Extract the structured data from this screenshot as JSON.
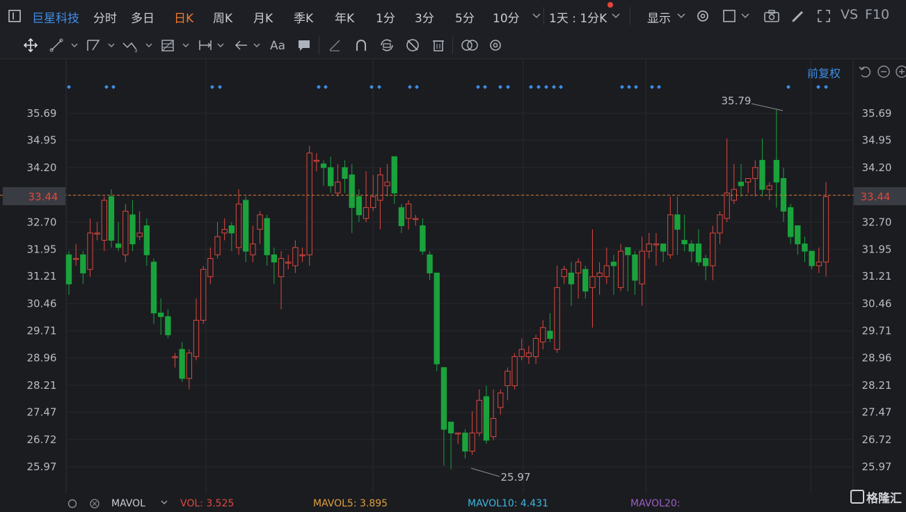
{
  "header": {
    "stock_name": "巨星科技",
    "periods": [
      "分时",
      "多日",
      "日K",
      "周K",
      "月K",
      "季K",
      "年K",
      "1分",
      "3分",
      "5分",
      "10分"
    ],
    "active_period": "日K",
    "interval_select": "1天 : 1分K",
    "display_label": "显示",
    "vs_label": "VS",
    "f10_label": "F10"
  },
  "toolbar": {
    "adjust_label": "前复权"
  },
  "price_axis": {
    "ticks": [
      "35.69",
      "34.95",
      "34.20",
      "33.44",
      "32.70",
      "31.95",
      "31.21",
      "30.46",
      "29.71",
      "28.96",
      "28.21",
      "27.47",
      "26.72",
      "25.97"
    ],
    "current_price": "33.44"
  },
  "annotations": {
    "high": "35.79",
    "low": "25.97"
  },
  "chart_data": {
    "type": "candlestick",
    "ylim": [
      25.6,
      36.2
    ],
    "up_color": "#e0483e",
    "down_color": "#1aa33c",
    "current_line": 33.44,
    "candles": [
      [
        31.8,
        31.0,
        31.9,
        30.7
      ],
      [
        31.7,
        31.7,
        32.1,
        31.5
      ],
      [
        31.8,
        31.3,
        31.9,
        31.0
      ],
      [
        31.4,
        32.4,
        32.8,
        31.2
      ],
      [
        32.4,
        32.4,
        32.7,
        32.2
      ],
      [
        32.2,
        33.3,
        33.4,
        31.9
      ],
      [
        33.4,
        32.2,
        33.6,
        32.0
      ],
      [
        32.1,
        32.0,
        32.7,
        31.9
      ],
      [
        31.8,
        33.0,
        33.2,
        31.6
      ],
      [
        32.9,
        32.1,
        33.3,
        31.9
      ],
      [
        32.3,
        32.4,
        33.0,
        32.2
      ],
      [
        32.6,
        31.8,
        32.8,
        31.5
      ],
      [
        31.6,
        30.2,
        31.7,
        29.9
      ],
      [
        30.2,
        30.1,
        30.6,
        29.6
      ],
      [
        30.1,
        29.6,
        30.3,
        29.5
      ],
      [
        29.0,
        29.0,
        29.1,
        28.7
      ],
      [
        29.2,
        28.4,
        29.4,
        28.3
      ],
      [
        28.4,
        29.1,
        29.2,
        28.1
      ],
      [
        29.0,
        30.0,
        30.6,
        28.9
      ],
      [
        30.0,
        31.4,
        31.5,
        29.9
      ],
      [
        31.2,
        31.7,
        32.0,
        31.0
      ],
      [
        31.8,
        32.3,
        32.7,
        31.7
      ],
      [
        32.4,
        32.5,
        32.8,
        32.2
      ],
      [
        32.6,
        32.4,
        32.7,
        31.9
      ],
      [
        32.0,
        33.2,
        33.6,
        31.8
      ],
      [
        33.3,
        31.9,
        33.4,
        31.6
      ],
      [
        31.8,
        32.1,
        32.6,
        31.6
      ],
      [
        32.5,
        32.9,
        33.0,
        32.1
      ],
      [
        32.8,
        31.8,
        32.9,
        31.5
      ],
      [
        31.8,
        31.6,
        32.0,
        31.0
      ],
      [
        31.2,
        31.7,
        31.9,
        30.3
      ],
      [
        31.6,
        31.6,
        31.8,
        31.4
      ],
      [
        31.5,
        32.0,
        32.2,
        31.3
      ],
      [
        31.8,
        31.8,
        32.0,
        31.6
      ],
      [
        31.8,
        34.6,
        34.8,
        31.5
      ],
      [
        34.4,
        34.4,
        34.6,
        34.1
      ],
      [
        34.3,
        34.2,
        34.4,
        33.7
      ],
      [
        34.2,
        33.7,
        34.5,
        33.5
      ],
      [
        33.5,
        33.8,
        34.3,
        33.4
      ],
      [
        34.2,
        33.9,
        34.4,
        33.5
      ],
      [
        34.0,
        33.1,
        34.3,
        32.4
      ],
      [
        33.4,
        32.9,
        33.6,
        32.7
      ],
      [
        32.8,
        33.1,
        34.1,
        32.7
      ],
      [
        33.1,
        33.4,
        34.0,
        33.0
      ],
      [
        33.3,
        34.0,
        34.2,
        32.5
      ],
      [
        33.7,
        33.8,
        34.3,
        33.4
      ],
      [
        34.5,
        33.5,
        34.5,
        33.2
      ],
      [
        33.1,
        32.6,
        33.2,
        32.4
      ],
      [
        32.8,
        33.2,
        33.3,
        32.5
      ],
      [
        32.8,
        32.8,
        32.9,
        32.6
      ],
      [
        32.6,
        31.9,
        32.8,
        31.8
      ],
      [
        31.8,
        31.3,
        31.9,
        31.1
      ],
      [
        31.3,
        28.8,
        31.3,
        28.6
      ],
      [
        28.7,
        27.0,
        28.7,
        26.0
      ],
      [
        27.2,
        26.9,
        27.2,
        25.9
      ],
      [
        26.9,
        26.9,
        26.9,
        26.6
      ],
      [
        26.9,
        26.4,
        27.0,
        26.2
      ],
      [
        26.4,
        26.9,
        27.5,
        26.3
      ],
      [
        26.9,
        27.8,
        28.1,
        26.8
      ],
      [
        27.9,
        26.7,
        28.2,
        26.6
      ],
      [
        26.8,
        27.3,
        28.1,
        26.7
      ],
      [
        27.6,
        28.0,
        28.1,
        27.4
      ],
      [
        28.2,
        28.6,
        28.7,
        27.8
      ],
      [
        28.2,
        29.0,
        29.1,
        28.1
      ],
      [
        29.0,
        29.2,
        29.5,
        28.9
      ],
      [
        29.0,
        29.1,
        29.3,
        28.8
      ],
      [
        29.0,
        29.5,
        29.6,
        28.8
      ],
      [
        29.4,
        29.8,
        30.0,
        29.2
      ],
      [
        29.7,
        29.5,
        30.2,
        29.4
      ],
      [
        29.2,
        30.9,
        31.5,
        29.1
      ],
      [
        31.2,
        31.4,
        31.5,
        31.0
      ],
      [
        31.3,
        31.0,
        31.6,
        30.4
      ],
      [
        31.3,
        31.6,
        31.7,
        30.6
      ],
      [
        31.4,
        30.8,
        31.5,
        30.6
      ],
      [
        30.9,
        31.2,
        32.5,
        29.8
      ],
      [
        31.2,
        31.3,
        31.6,
        30.7
      ],
      [
        31.2,
        31.5,
        32.0,
        31.0
      ],
      [
        31.6,
        31.5,
        31.8,
        30.7
      ],
      [
        30.9,
        31.9,
        32.1,
        30.8
      ],
      [
        32.0,
        31.8,
        32.0,
        30.8
      ],
      [
        31.8,
        31.1,
        31.9,
        30.7
      ],
      [
        31.0,
        31.9,
        32.3,
        30.4
      ],
      [
        31.9,
        32.1,
        32.4,
        31.7
      ],
      [
        32.1,
        32.1,
        32.4,
        31.5
      ],
      [
        32.1,
        31.9,
        32.1,
        31.6
      ],
      [
        31.8,
        32.9,
        33.4,
        31.7
      ],
      [
        32.9,
        32.5,
        33.4,
        31.8
      ],
      [
        32.2,
        32.1,
        32.9,
        31.9
      ],
      [
        32.1,
        31.9,
        32.2,
        31.6
      ],
      [
        32.1,
        31.6,
        32.5,
        31.5
      ],
      [
        31.7,
        31.5,
        31.8,
        31.1
      ],
      [
        31.5,
        32.4,
        32.6,
        31.1
      ],
      [
        32.4,
        32.9,
        33.0,
        32.1
      ],
      [
        32.8,
        33.5,
        35.0,
        32.7
      ],
      [
        33.3,
        33.6,
        34.3,
        33.2
      ],
      [
        33.8,
        33.7,
        34.3,
        33.4
      ],
      [
        33.8,
        33.9,
        33.9,
        33.5
      ],
      [
        33.9,
        34.2,
        34.4,
        33.4
      ],
      [
        34.4,
        33.6,
        35.0,
        33.4
      ],
      [
        33.6,
        33.7,
        33.8,
        33.3
      ],
      [
        34.4,
        33.8,
        35.79,
        33.1
      ],
      [
        33.9,
        33.0,
        34.2,
        32.7
      ],
      [
        33.1,
        32.3,
        33.2,
        32.1
      ],
      [
        32.6,
        32.1,
        32.6,
        31.8
      ],
      [
        32.1,
        31.9,
        32.3,
        31.6
      ],
      [
        31.9,
        31.5,
        31.9,
        31.4
      ],
      [
        31.5,
        31.6,
        32.0,
        31.3
      ],
      [
        31.6,
        33.4,
        33.8,
        31.2
      ]
    ],
    "event_markers": [
      0,
      3,
      4,
      12,
      13,
      19,
      20,
      23,
      24,
      27,
      28,
      32,
      33,
      35,
      36,
      40,
      41,
      42,
      43,
      44,
      48,
      49,
      50,
      52,
      53,
      59,
      60
    ]
  },
  "volume_bar": {
    "mavol_label": "MAVOL",
    "vol": "VOL: 3.525",
    "mavol5": "MAVOL5: 3.895",
    "mavol10": "MAVOL10: 4.431",
    "mavol20": "MAVOL20:"
  },
  "brand": {
    "name": "格隆汇"
  },
  "colors": {
    "accent": "#3f8ee8",
    "active": "#f07a2f",
    "up": "#e0483e",
    "down": "#1aa33c"
  }
}
